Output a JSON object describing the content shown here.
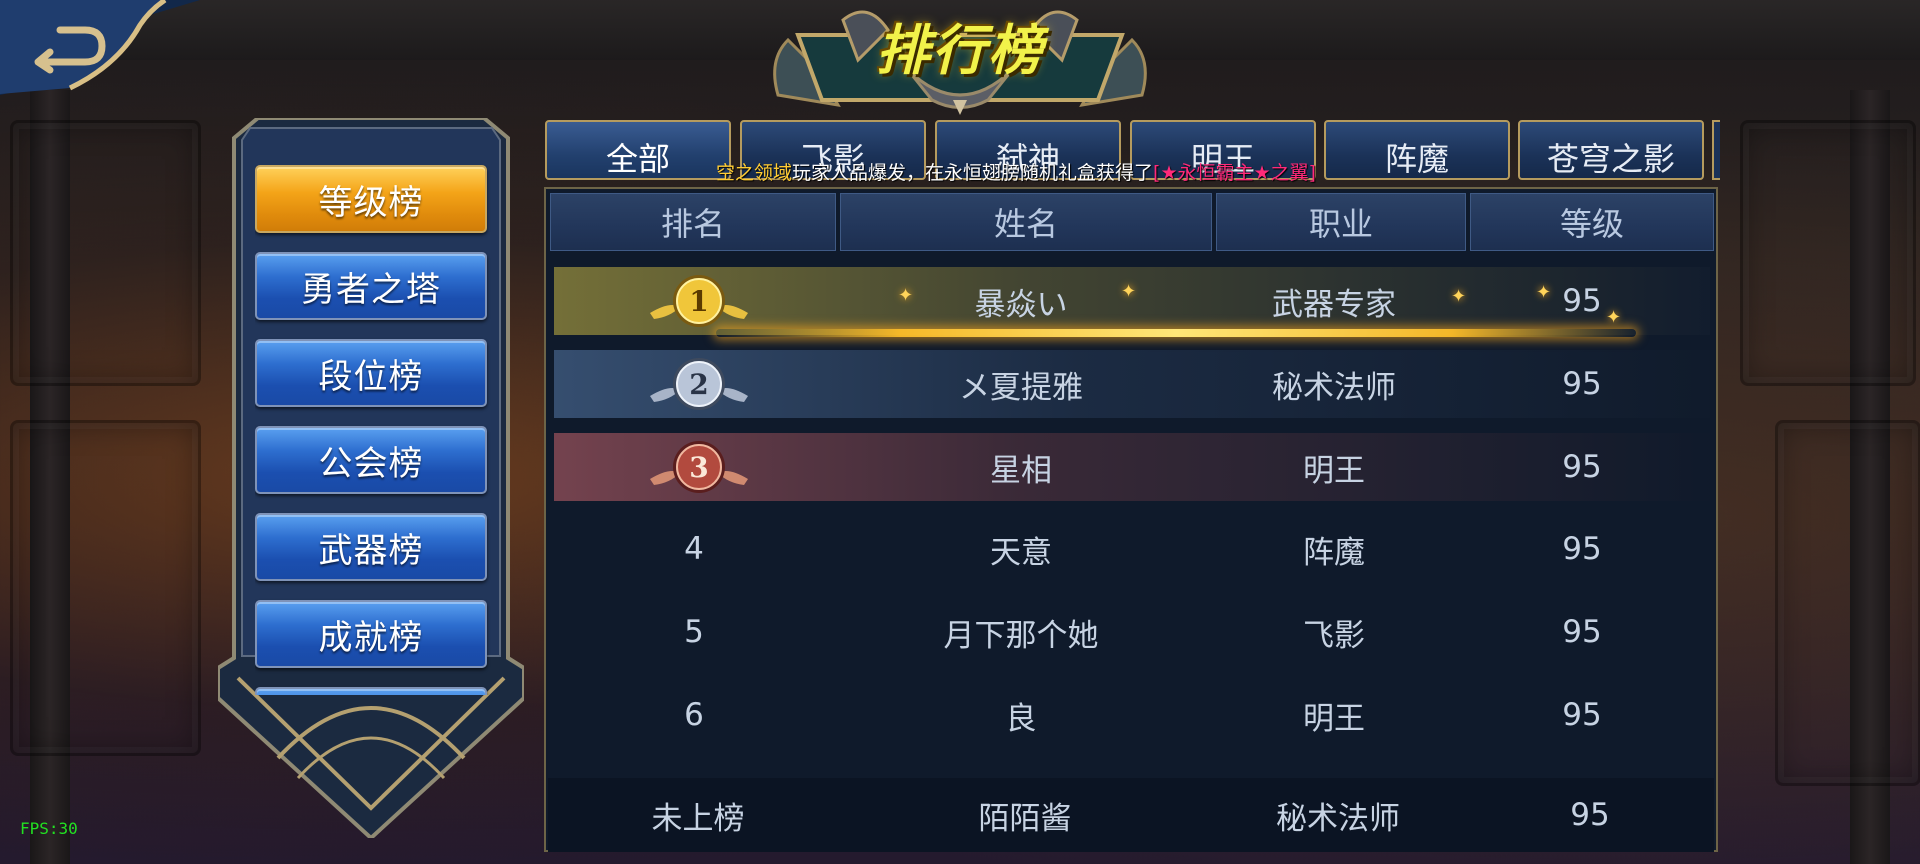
{
  "title": "排行榜",
  "tabs": [
    {
      "label": "全部"
    },
    {
      "label": "飞影"
    },
    {
      "label": "弑神"
    },
    {
      "label": "明王"
    },
    {
      "label": "阵魔"
    },
    {
      "label": "苍穹之影"
    }
  ],
  "ticker": {
    "player": "空之领域",
    "text_mid": "玩家人品爆发，在永恒翅膀随机礼盒获得了",
    "item": "[★永恒霸主★之翼]"
  },
  "side_menu": [
    {
      "label": "等级榜",
      "active": true
    },
    {
      "label": "勇者之塔"
    },
    {
      "label": "段位榜"
    },
    {
      "label": "公会榜"
    },
    {
      "label": "武器榜"
    },
    {
      "label": "成就榜"
    }
  ],
  "table": {
    "headers": {
      "rank": "排名",
      "name": "姓名",
      "job": "职业",
      "level": "等级"
    },
    "rows": [
      {
        "rank": "1",
        "name": "暴焱い",
        "job": "武器专家",
        "level": "95",
        "medal": "gold"
      },
      {
        "rank": "2",
        "name": "メ夏提雅",
        "job": "秘术法师",
        "level": "95",
        "medal": "silver"
      },
      {
        "rank": "3",
        "name": "星相",
        "job": "明王",
        "level": "95",
        "medal": "bronze"
      },
      {
        "rank": "4",
        "name": "天意",
        "job": "阵魔",
        "level": "95"
      },
      {
        "rank": "5",
        "name": "月下那个她",
        "job": "飞影",
        "level": "95"
      },
      {
        "rank": "6",
        "name": "良",
        "job": "明王",
        "level": "95"
      }
    ],
    "self": {
      "rank": "未上榜",
      "name": "陌陌酱",
      "job": "秘术法师",
      "level": "95"
    }
  },
  "fps": "FPS:30",
  "colors": {
    "accent_gold": "#f4a418",
    "tab_blue": "#1b3258",
    "ticker_gold": "#ffcc33",
    "ticker_pink": "#ff2a7a"
  }
}
